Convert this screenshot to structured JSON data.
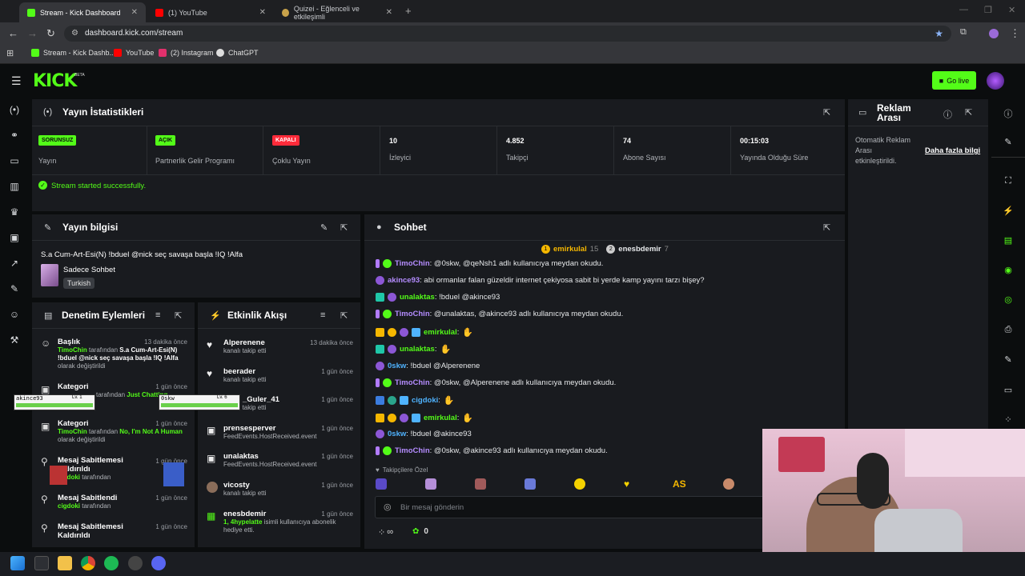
{
  "browser": {
    "tabs": [
      {
        "title": "Stream - Kick Dashboard",
        "active": true
      },
      {
        "title": "(1) YouTube",
        "active": false
      },
      {
        "title": "Quizei - Eğlenceli ve etkileşimli",
        "active": false
      }
    ],
    "url": "dashboard.kick.com/stream",
    "bookmarks": [
      "Stream - Kick Dashb...",
      "YouTube",
      "(2) Instagram",
      "ChatGPT"
    ]
  },
  "header": {
    "logo": "KICK",
    "beta": "BETA",
    "go_live": "Go live"
  },
  "stats": {
    "title": "Yayın İstatistikleri",
    "items": [
      {
        "badge": "SORUNSUZ",
        "label": "Yayın",
        "color": "#53fc18"
      },
      {
        "badge": "AÇIK",
        "label": "Partnerlik Gelir Programı",
        "color": "#53fc18"
      },
      {
        "badge": "KAPALI",
        "label": "Çoklu Yayın",
        "color": "#ff2b3a"
      },
      {
        "value": "10",
        "label": "İzleyici"
      },
      {
        "value": "4.852",
        "label": "Takipçi"
      },
      {
        "value": "74",
        "label": "Abone Sayısı"
      },
      {
        "value": "00:15:03",
        "label": "Yayında Olduğu Süre"
      }
    ],
    "status": "Stream started successfully."
  },
  "ad_break": {
    "title_line1": "Reklam",
    "title_line2": "Arası",
    "text_line1": "Otomatik Reklam",
    "text_line2": "Arası",
    "text_line3": "etkinleştirildi.",
    "link": "Daha fazla bilgi"
  },
  "stream_info": {
    "title": "Yayın bilgisi",
    "stream_title": "S.a Cum-Art-Esi(N) !bduel @nick seç savaşa başla !IQ !Alfa",
    "category": "Sadece Sohbet",
    "tag": "Turkish"
  },
  "moderation": {
    "title": "Denetim Eylemleri",
    "items": [
      {
        "title": "Başlık",
        "time": "13 dakika önce",
        "user": "TimoChin",
        "by": "tarafından",
        "value": "S.a Cum-Art-Esi(N) !bduel @nick seç savaşa başla !IQ !Alfa",
        "suffix": "olarak değiştirildi"
      },
      {
        "title": "Kategori",
        "time": "1 gün önce",
        "by": "tarafından",
        "value": "Just Chatting"
      },
      {
        "title": "Kategori",
        "time": "1 gün önce",
        "user": "TimoChin",
        "by": "tarafından",
        "value": "No, I'm Not A Human",
        "suffix": "olarak değiştirildi"
      },
      {
        "title": "Mesaj Sabitlemesi Kaldırıldı",
        "time": "1 gün önce",
        "user": "cigdoki",
        "by": "tarafından"
      },
      {
        "title": "Mesaj Sabitlendi",
        "time": "1 gün önce",
        "user": "cigdoki",
        "by": "tarafından"
      },
      {
        "title": "Mesaj Sabitlemesi Kaldırıldı",
        "time": "1 gün önce"
      }
    ]
  },
  "activity": {
    "title": "Etkinlik Akışı",
    "items": [
      {
        "name": "Alperenene",
        "sub": "kanalı takip etti",
        "time": "13 dakika önce"
      },
      {
        "name": "beerader",
        "sub": "kanalı takip etti",
        "time": "1 gün önce"
      },
      {
        "name": "_Guler_41",
        "sub": "kanalı takip etti",
        "time": "1 gün önce"
      },
      {
        "name": "prensesperver",
        "sub": "FeedEvents.HostReceived.event",
        "time": "1 gün önce"
      },
      {
        "name": "unalaktas",
        "sub": "FeedEvents.HostReceived.event",
        "time": "1 gün önce"
      },
      {
        "name": "vicosty",
        "sub": "kanalı takip etti",
        "time": "1 gün önce"
      },
      {
        "name": "enesbdemir",
        "sub_green": "1, 4hypelatte",
        "sub": "isimli kullanıcıya abonelik hediye etti.",
        "time": "1 gün önce"
      }
    ]
  },
  "overlay": {
    "player1": {
      "name": "akince93",
      "level": "Lv. 1"
    },
    "player2": {
      "name": "0skw",
      "level": "Lv. 6"
    }
  },
  "chat": {
    "title": "Sohbet",
    "leaders": [
      {
        "rank": "1",
        "name": "emirkulal",
        "count": "15"
      },
      {
        "rank": "2",
        "name": "enesbdemir",
        "count": "7"
      }
    ],
    "messages": [
      {
        "user": "TimoChin",
        "color": "#b48cff",
        "text": ": @0skw, @qeNsh1 adlı kullanıcıya meydan okudu."
      },
      {
        "user": "akince93",
        "color": "#b48cff",
        "text": ": abi ormanlar falan güzeldir internet çekiyosa sabit bi yerde kamp yayını tarzı bişey?"
      },
      {
        "user": "unalaktas",
        "color": "#53fc18",
        "text": ": !bduel @akince93"
      },
      {
        "user": "TimoChin",
        "color": "#b48cff",
        "text": ": @unalaktas, @akince93 adlı kullanıcıya meydan okudu."
      },
      {
        "user": "emirkulal",
        "color": "#53fc18",
        "text": ": "
      },
      {
        "user": "unalaktas",
        "color": "#53fc18",
        "text": ": "
      },
      {
        "user": "0skw",
        "color": "#4fb3ff",
        "text": ": !bduel @Alperenene"
      },
      {
        "user": "TimoChin",
        "color": "#b48cff",
        "text": ": @0skw, @Alperenene adlı kullanıcıya meydan okudu."
      },
      {
        "user": "cigdoki",
        "color": "#4fb3ff",
        "text": ": "
      },
      {
        "user": "emirkulal",
        "color": "#53fc18",
        "text": ": "
      },
      {
        "user": "0skw",
        "color": "#4fb3ff",
        "text": ": !bduel @akince93"
      },
      {
        "user": "TimoChin",
        "color": "#b48cff",
        "text": ": @0skw, @akince93 adlı kullanıcıya meydan okudu."
      }
    ],
    "followers_label": "Takipçilere Özel",
    "emote_text": "AS",
    "input_placeholder": "Bir mesaj gönderin",
    "points_symbol": "∞",
    "points_count": "0"
  }
}
